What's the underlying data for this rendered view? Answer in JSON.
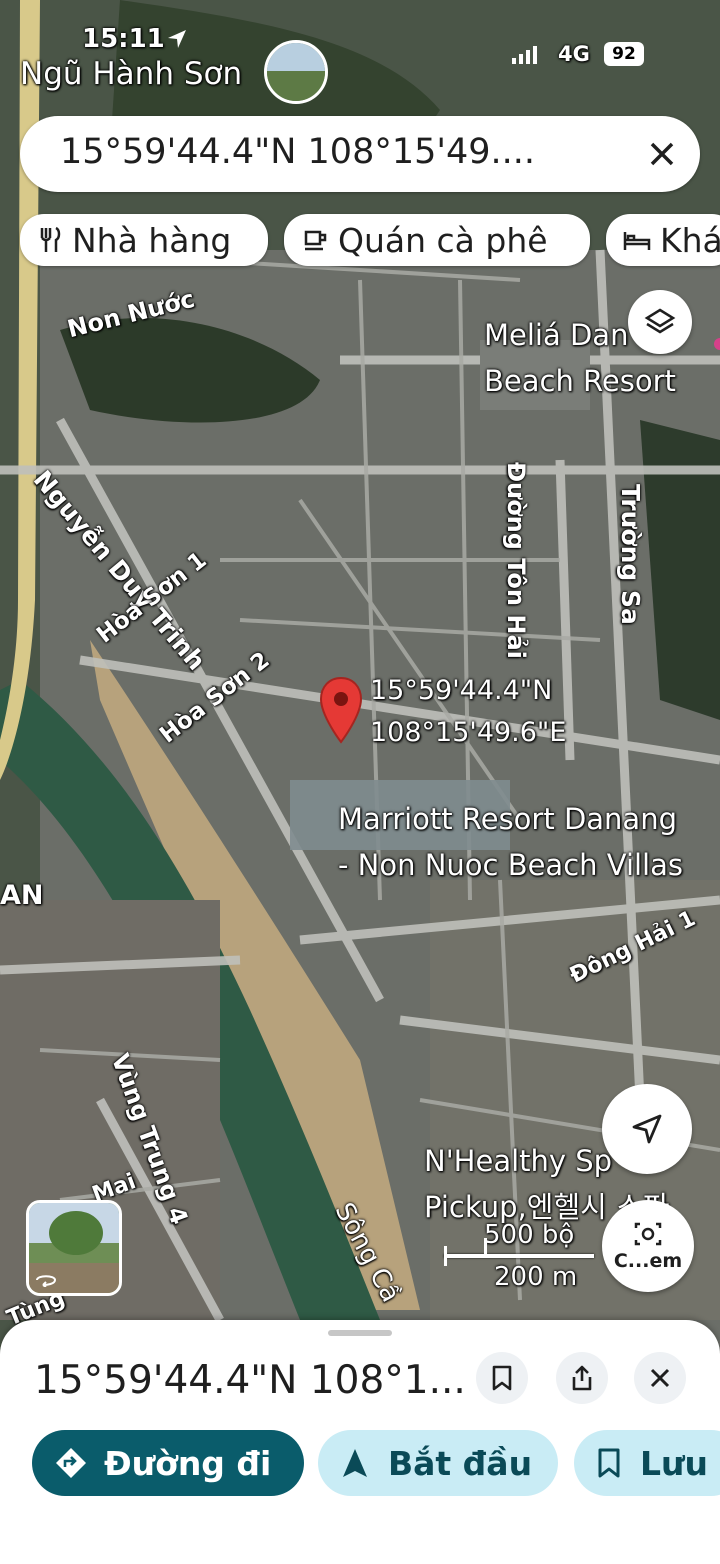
{
  "status_bar": {
    "time": "15:11",
    "network": "4G",
    "battery": "92"
  },
  "place_header": {
    "title": "Ngũ Hành Sơn"
  },
  "search": {
    "value": "15°59'44.4\"N 108°15'49...."
  },
  "chips": [
    {
      "label": "Nhà hàng",
      "icon": "restaurant-icon"
    },
    {
      "label": "Quán cà phê",
      "icon": "coffee-icon"
    },
    {
      "label": "Khá",
      "icon": "hotel-icon"
    }
  ],
  "map_labels": {
    "non_nuoc": "Non Nước",
    "nguyen_duy_trinh": "Nguyễn Duy Trinh",
    "hoa_son_1": "Hòa Sơn 1",
    "hoa_son_2": "Hòa Sơn 2",
    "duong_ton_hai": "Đường Tôn Hải",
    "truong_sa": "Trường Sa",
    "melia": [
      "Meliá Dan",
      "Beach Resort"
    ],
    "marriott": [
      "Marriott Resort Danang",
      "- Non Nuoc Beach Villas"
    ],
    "dong_hai_1": "Đông Hải 1",
    "an": "AN",
    "vung_trung_4": "Vùng Trung 4",
    "mai": "Mai",
    "tung": "Tùng",
    "song_cau": "Sông Cầ",
    "nhealthy": [
      "N'Healthy Sp",
      "Pickup,엔헬시 스파"
    ]
  },
  "pin": {
    "label_lat": "15°59'44.4\"N",
    "label_lng": "108°15'49.6\"E"
  },
  "scale": {
    "imperial": "500 bộ",
    "metric": "200 m"
  },
  "camera_btn": {
    "label": "C...em"
  },
  "bottom_sheet": {
    "title": "15°59'44.4\"N 108°1...",
    "buttons": {
      "directions": "Đường đi",
      "start": "Bắt đầu",
      "save": "Lưu"
    }
  },
  "colors": {
    "accent_teal": "#0b57d0",
    "directions_bg": "#0a5c6b",
    "start_bg": "#c9ecf5",
    "save_bg": "#c9ecf5",
    "pin_red": "#e53935",
    "river": "#2f5a45"
  }
}
